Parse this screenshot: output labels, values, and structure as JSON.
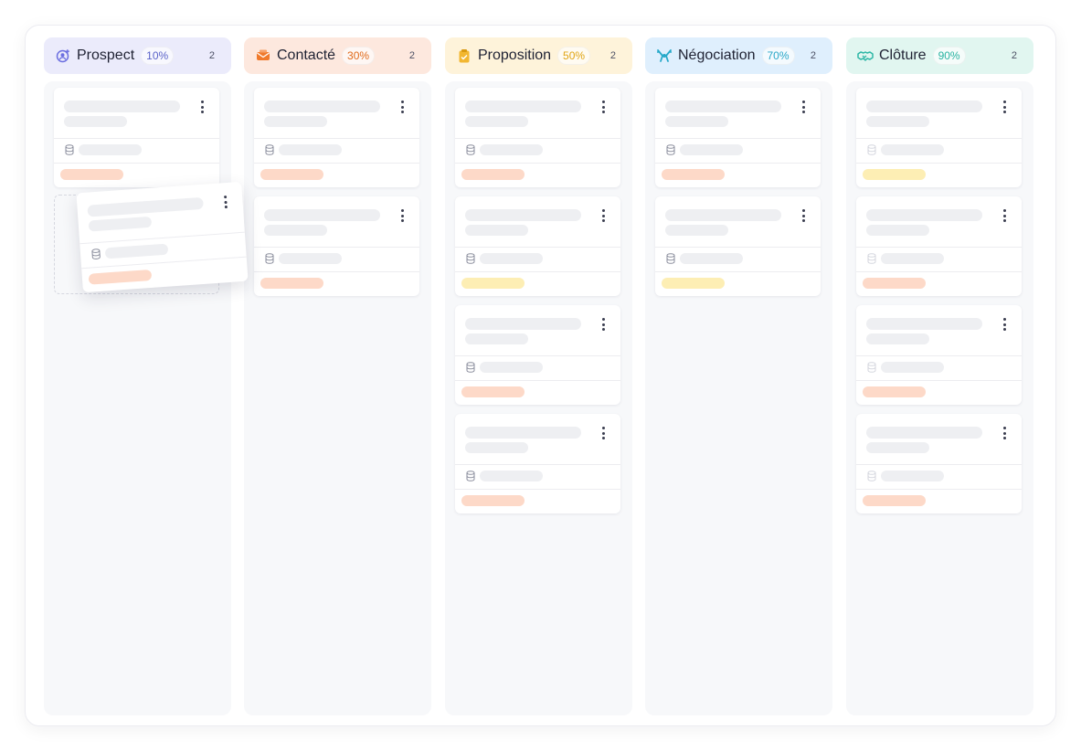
{
  "columns": [
    {
      "title": "Prospect",
      "pct": "10%",
      "count": "2",
      "icon": "user-plus-icon",
      "header_bg": "#ebebfb",
      "pct_color": "#5b63c9",
      "icon_color": "#6c6fe0",
      "cards": [
        {
          "tag_color": "#fdd9c8",
          "db_faded": false
        }
      ]
    },
    {
      "title": "Contacté",
      "pct": "30%",
      "count": "2",
      "icon": "envelope-icon",
      "header_bg": "#fde8de",
      "pct_color": "#e06a1b",
      "icon_color": "#f07a2c",
      "cards": [
        {
          "tag_color": "#fdd9c8",
          "db_faded": false
        },
        {
          "tag_color": "#fdd9c8",
          "db_faded": false
        }
      ]
    },
    {
      "title": "Proposition",
      "pct": "50%",
      "count": "2",
      "icon": "clipboard-check-icon",
      "header_bg": "#fef3da",
      "pct_color": "#e0a515",
      "icon_color": "#f2b731",
      "cards": [
        {
          "tag_color": "#fdd9c8",
          "db_faded": false
        },
        {
          "tag_color": "#fdeeb4",
          "db_faded": false
        },
        {
          "tag_color": "#fdd9c8",
          "db_faded": false
        },
        {
          "tag_color": "#fdd9c8",
          "db_faded": false
        }
      ]
    },
    {
      "title": "Négociation",
      "pct": "70%",
      "count": "2",
      "icon": "arrows-negotiation-icon",
      "header_bg": "#dfeffd",
      "pct_color": "#2aa7c8",
      "icon_color": "#27a9c9",
      "cards": [
        {
          "tag_color": "#fdd9c8",
          "db_faded": false
        },
        {
          "tag_color": "#fdeeb4",
          "db_faded": false
        }
      ]
    },
    {
      "title": "Clôture",
      "pct": "90%",
      "count": "2",
      "icon": "handshake-icon",
      "header_bg": "#e1f6f0",
      "pct_color": "#2ab3a1",
      "icon_color": "#2db7a6",
      "cards": [
        {
          "tag_color": "#fdeeb4",
          "db_faded": true
        },
        {
          "tag_color": "#fdd9c8",
          "db_faded": true
        },
        {
          "tag_color": "#fdd9c8",
          "db_faded": true
        },
        {
          "tag_color": "#fdd9c8",
          "db_faded": true
        }
      ]
    }
  ],
  "dragging_card": {
    "tag_color": "#fdd9c8",
    "source_column": "Prospect"
  }
}
